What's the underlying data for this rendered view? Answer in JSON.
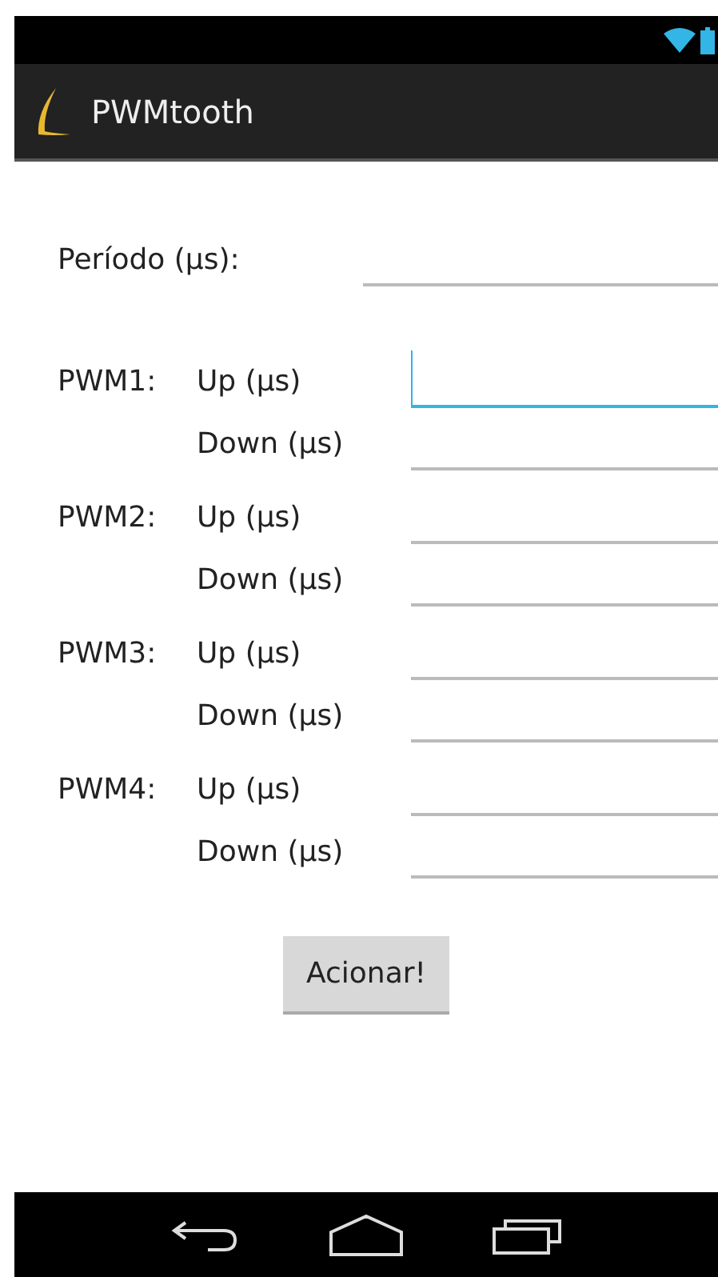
{
  "app_bar": {
    "title": "PWMtooth"
  },
  "period": {
    "label": "Período (µs):",
    "focused": false
  },
  "pwm": [
    {
      "label": "PWM1:",
      "fields": [
        {
          "label": "Up (µs)",
          "focused": true
        },
        {
          "label": "Down (µs)",
          "focused": false
        }
      ]
    },
    {
      "label": "PWM2:",
      "fields": [
        {
          "label": "Up (µs)",
          "focused": false
        },
        {
          "label": "Down (µs)",
          "focused": false
        }
      ]
    },
    {
      "label": "PWM3:",
      "fields": [
        {
          "label": "Up (µs)",
          "focused": false
        },
        {
          "label": "Down (µs)",
          "focused": false
        }
      ]
    },
    {
      "label": "PWM4:",
      "fields": [
        {
          "label": "Up (µs)",
          "focused": false
        },
        {
          "label": "Down (µs)",
          "focused": false
        }
      ]
    }
  ],
  "button": {
    "label": "Acionar!"
  }
}
